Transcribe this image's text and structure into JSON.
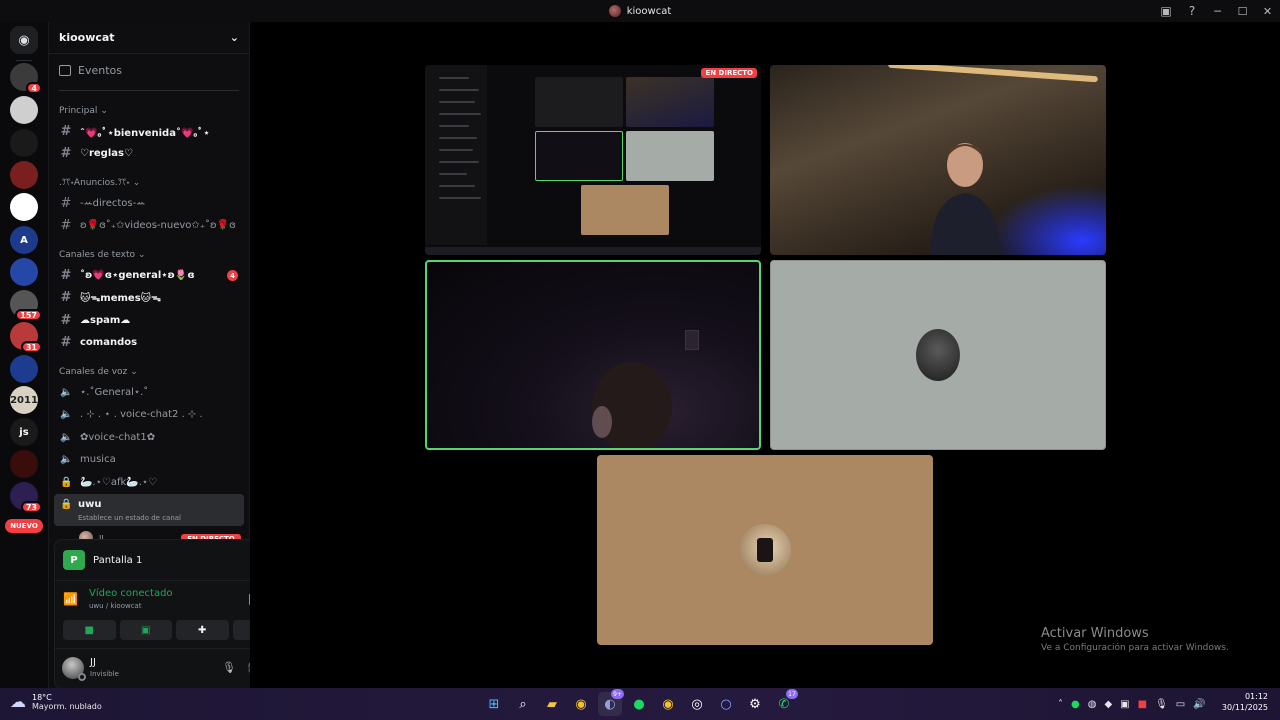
{
  "window": {
    "title": "kioowcat"
  },
  "rail": {
    "home_icon": "discord-logo-icon",
    "servers": [
      {
        "color": "#3b3b3b",
        "label": "",
        "badge": "4"
      },
      {
        "color": "#cfcfcf",
        "label": "",
        "badge": ""
      },
      {
        "color": "#1a1a1a",
        "label": "",
        "badge": ""
      },
      {
        "color": "#7a1f1f",
        "label": "",
        "badge": ""
      },
      {
        "color": "#ffffff",
        "label": "",
        "badge": ""
      },
      {
        "color": "#1e3a8a",
        "label": "A",
        "badge": ""
      },
      {
        "color": "#2447a8",
        "label": "",
        "badge": ""
      },
      {
        "color": "#555555",
        "label": "",
        "badge": "157"
      },
      {
        "color": "#b83a3a",
        "label": "",
        "badge": "31"
      },
      {
        "color": "#1d3b8f",
        "label": "",
        "badge": ""
      },
      {
        "color": "#d9d2c2",
        "label": "2011",
        "badge": ""
      },
      {
        "color": "#1a1a1a",
        "label": "js",
        "badge": ""
      },
      {
        "color": "#3a0d0d",
        "label": "",
        "badge": ""
      },
      {
        "color": "#2d1f4f",
        "label": "",
        "badge": "73"
      }
    ],
    "new_label": "NUEVO"
  },
  "guild": {
    "name": "kioowcat",
    "events_label": "Eventos",
    "categories": [
      {
        "name": "Principal",
        "channels": [
          {
            "type": "text",
            "name": "ˆ💗｡ﾟ⋆bienvenida˚💗｡ﾟ⋆",
            "unread": true,
            "mentions": ""
          },
          {
            "type": "text",
            "name": "♡reglas♡",
            "unread": true,
            "mentions": ""
          }
        ]
      },
      {
        "name": ".ꔫ˖Anuncios.ꔫ˖",
        "channels": [
          {
            "type": "text",
            "name": "-ꕀdirectos-ꕀ",
            "unread": false,
            "mentions": ""
          },
          {
            "type": "text",
            "name": "ʚ🌹ɞ˚₊✩videos-nuevo✩₊˚ʚ🌹ɞ",
            "unread": false,
            "mentions": ""
          }
        ]
      },
      {
        "name": "Canales de texto",
        "channels": [
          {
            "type": "text",
            "name": "˚ʚ💗ɞ⋆general⋆ʚ🌷ɞ",
            "unread": true,
            "mentions": "4"
          },
          {
            "type": "text",
            "name": "🐱ᯓmemes🐱ᯓ",
            "unread": true,
            "mentions": ""
          },
          {
            "type": "text",
            "name": "☁spam☁",
            "unread": true,
            "mentions": ""
          },
          {
            "type": "text",
            "name": "comandos",
            "unread": true,
            "mentions": ""
          }
        ]
      },
      {
        "name": "Canales de voz",
        "channels": [
          {
            "type": "voice",
            "name": "⋆.˚General⋆.˚",
            "unread": false
          },
          {
            "type": "voice",
            "name": ". ⊹ . ⋆ . voice-chat2 . ⊹ .",
            "unread": false
          },
          {
            "type": "voice",
            "name": "✿voice-chat1✿",
            "unread": false
          },
          {
            "type": "voice",
            "name": "musica",
            "unread": false
          },
          {
            "type": "locked",
            "name": "🦢.⋆♡afk🦢.⋆♡",
            "unread": false
          }
        ]
      }
    ],
    "active_channel": {
      "name": "uwu",
      "status_placeholder": "Establece un estado de canal",
      "participant": "JJ",
      "live_label": "EN DIRECTO"
    }
  },
  "panel": {
    "share_label": "Pantalla 1",
    "voice_status": "Vídeo conectado",
    "voice_location": "uwu / kioowcat",
    "user_name": "JJ",
    "user_status": "Invisible"
  },
  "stage": {
    "live_tag": "EN DIRECTO"
  },
  "activation": {
    "title": "Activar Windows",
    "subtitle": "Ve a Configuración para activar Windows."
  },
  "taskbar": {
    "weather_temp": "18°C",
    "weather_desc": "Mayorm. nublado",
    "time": "01:12",
    "date": "30/11/2025",
    "discord_badge": "9+",
    "whatsapp_badge": "17"
  }
}
